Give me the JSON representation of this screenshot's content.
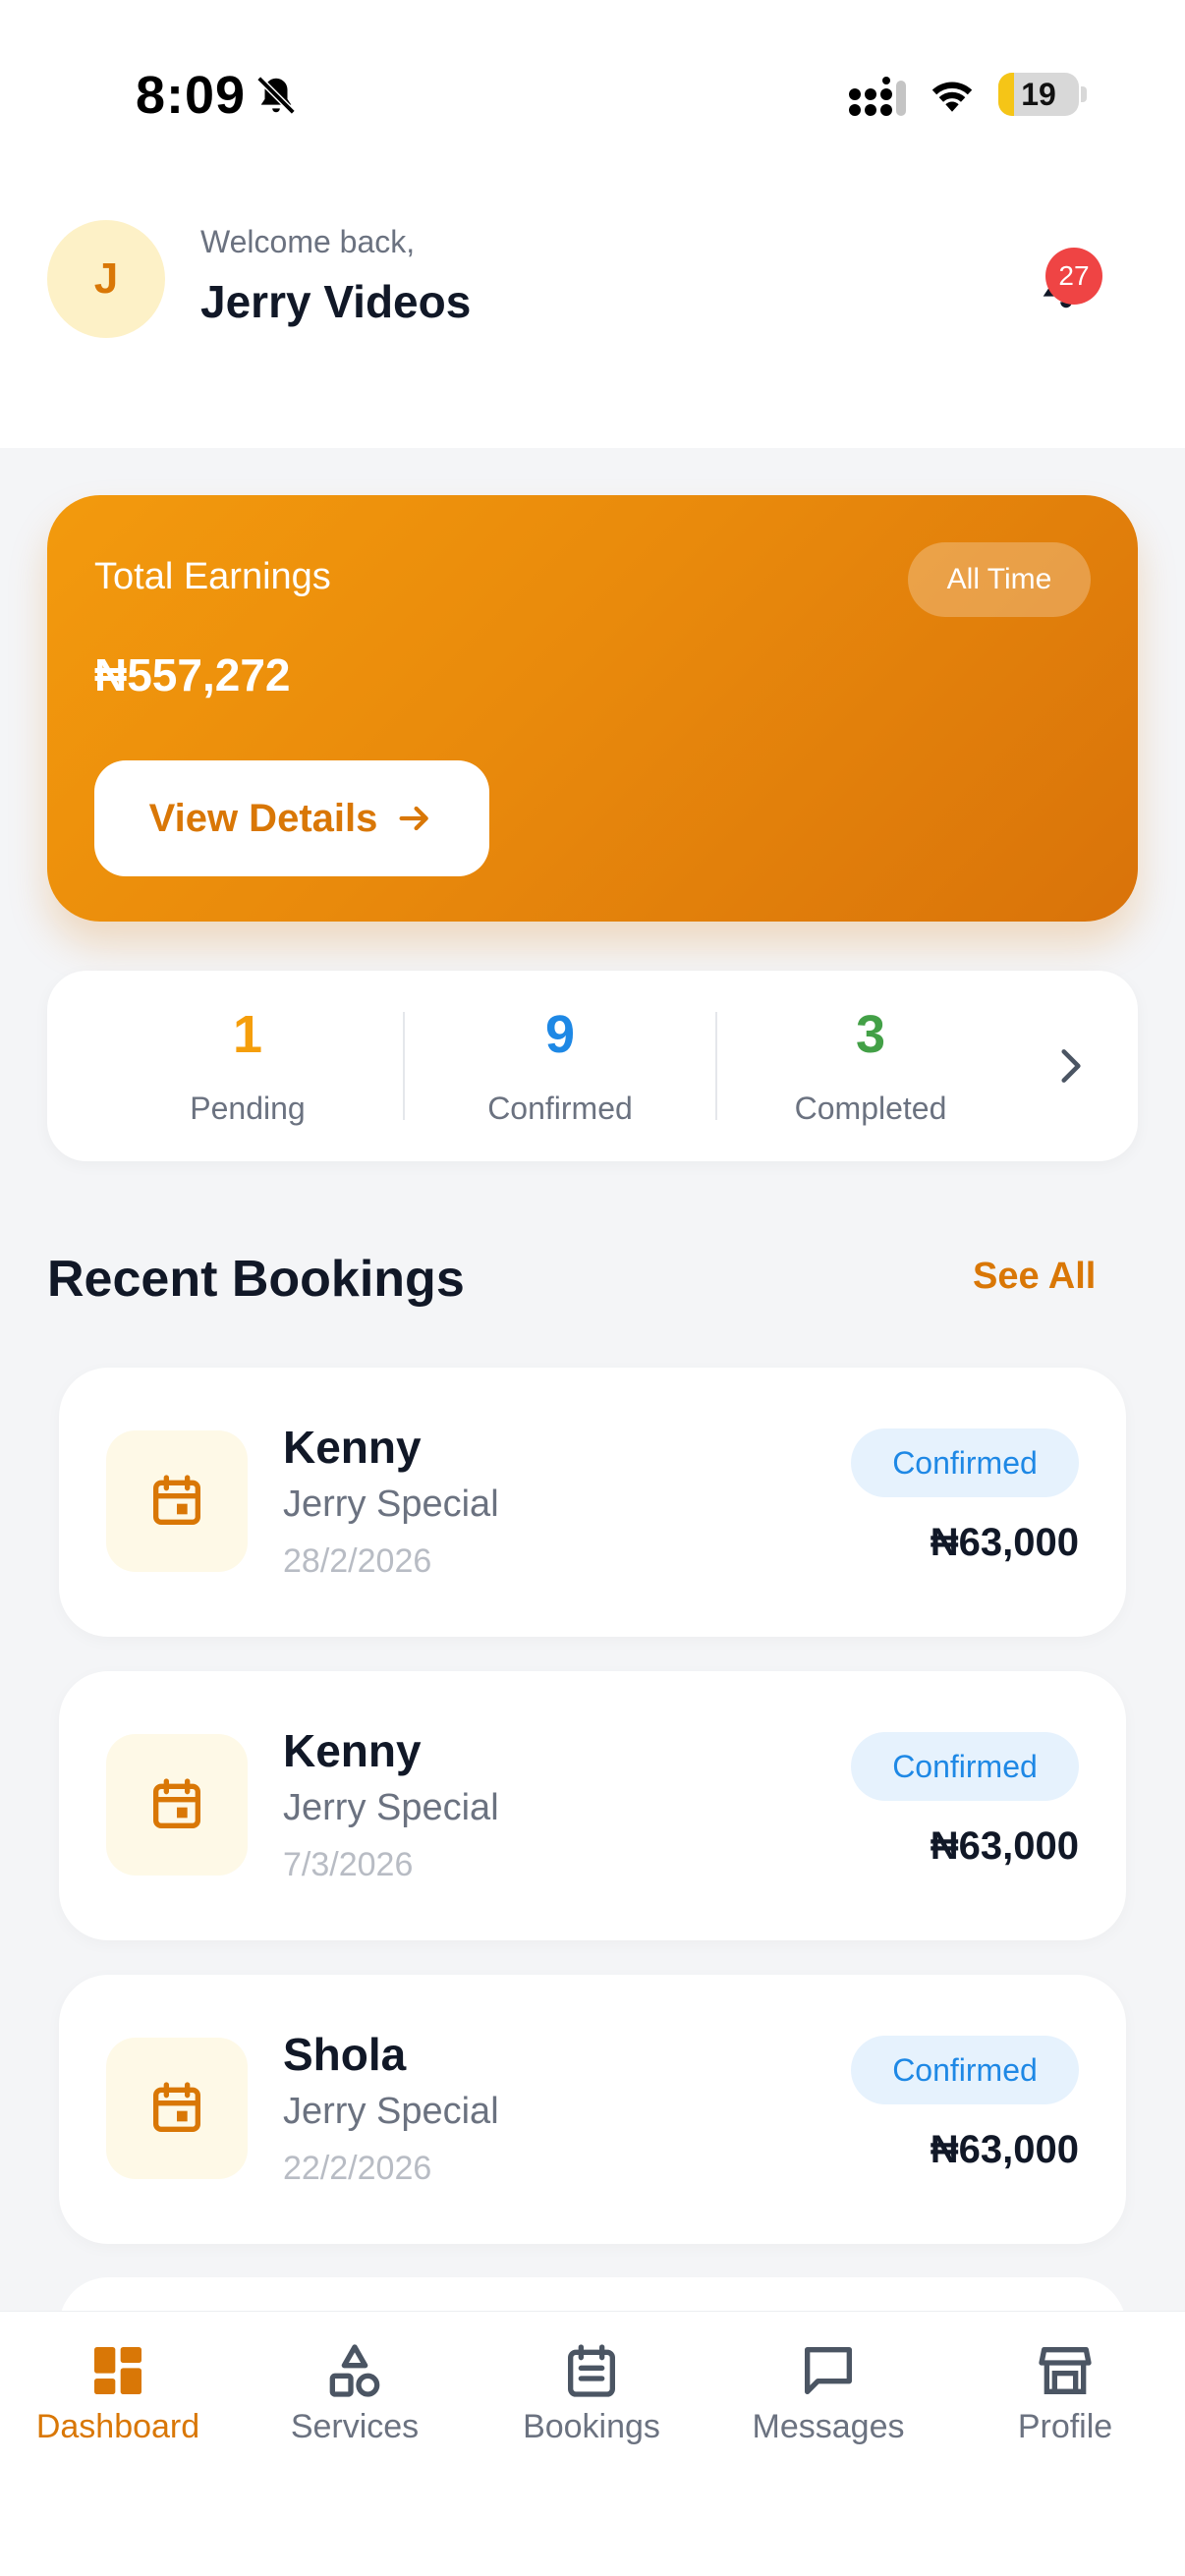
{
  "status_bar": {
    "time": "8:09",
    "battery": "19",
    "battery_level": 0.19
  },
  "header": {
    "avatar_initial": "J",
    "welcome": "Welcome back,",
    "name": "Jerry Videos",
    "notification_count": "27"
  },
  "earnings": {
    "label": "Total Earnings",
    "period": "All Time",
    "amount": "₦557,272",
    "button": "View Details"
  },
  "stats": [
    {
      "value": "1",
      "label": "Pending",
      "color": "#f59e0b"
    },
    {
      "value": "9",
      "label": "Confirmed",
      "color": "#1e88e5"
    },
    {
      "value": "3",
      "label": "Completed",
      "color": "#43a047"
    }
  ],
  "recent": {
    "title": "Recent Bookings",
    "see_all": "See All",
    "bookings": [
      {
        "name": "Kenny",
        "service": "Jerry Special",
        "date": "28/2/2026",
        "status": "Confirmed",
        "amount": "₦63,000"
      },
      {
        "name": "Kenny",
        "service": "Jerry Special",
        "date": "7/3/2026",
        "status": "Confirmed",
        "amount": "₦63,000"
      },
      {
        "name": "Shola",
        "service": "Jerry Special",
        "date": "22/2/2026",
        "status": "Confirmed",
        "amount": "₦63,000"
      }
    ]
  },
  "nav": {
    "items": [
      {
        "label": "Dashboard",
        "icon": "dashboard-icon",
        "active": true
      },
      {
        "label": "Services",
        "icon": "shapes-icon",
        "active": false
      },
      {
        "label": "Bookings",
        "icon": "calendar-icon",
        "active": false
      },
      {
        "label": "Messages",
        "icon": "message-icon",
        "active": false
      },
      {
        "label": "Profile",
        "icon": "store-icon",
        "active": false
      }
    ]
  },
  "colors": {
    "accent": "#d97706",
    "card_gradient_start": "#f39a0d",
    "card_gradient_end": "#d9730a"
  }
}
